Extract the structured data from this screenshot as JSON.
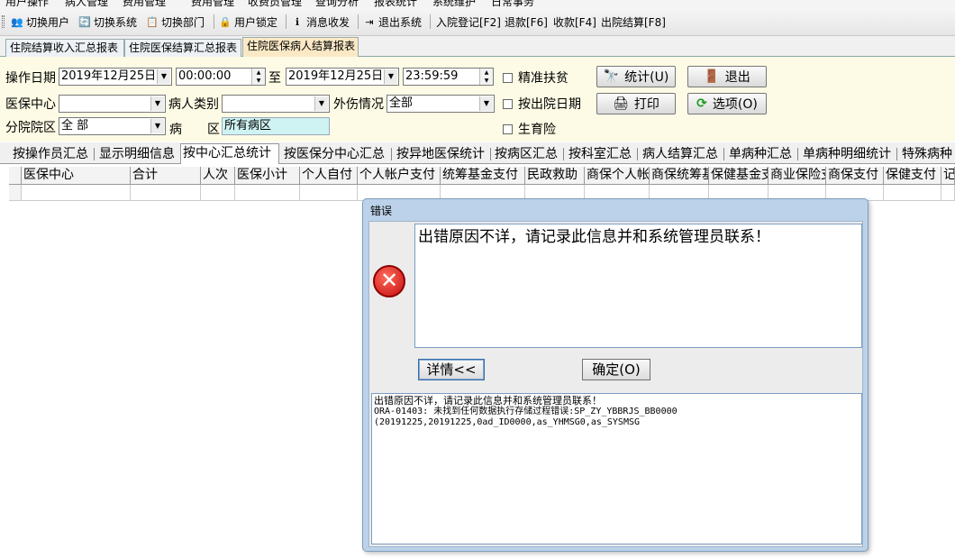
{
  "menubar": [
    "用户操作",
    "病人管理",
    "费用管理",
    "费用管理",
    "收费员管理",
    "查询分析",
    "报表统计",
    "系统维护",
    "日常事务"
  ],
  "toolbar": {
    "items": [
      {
        "label": "切换用户",
        "icon": "users-switch-icon"
      },
      {
        "label": "切换系统",
        "icon": "system-switch-icon"
      },
      {
        "label": "切换部门",
        "icon": "department-switch-icon"
      },
      {
        "label": "用户锁定",
        "icon": "user-lock-icon"
      },
      {
        "label": "消息收发",
        "icon": "info-icon"
      },
      {
        "label": "退出系统",
        "icon": "exit-icon"
      },
      {
        "label": "入院登记[F2]"
      },
      {
        "label": "退款[F6]"
      },
      {
        "label": "收款[F4]"
      },
      {
        "label": "出院结算[F8]"
      }
    ]
  },
  "report_tabs": [
    "住院结算收入汇总报表",
    "住院医保结算汇总报表",
    "住院医保病人结算报表"
  ],
  "filter": {
    "op_date_label": "操作日期",
    "date_from": "2019年12月25日",
    "time_from": "00:00:00",
    "to_label": "至",
    "date_to": "2019年12月25日",
    "time_to": "23:59:59",
    "precise_poverty": "精准扶贫",
    "by_discharge_date": "按出院日期",
    "maternity_insurance": "生育险",
    "insurance_center_label": "医保中心",
    "insurance_center_value": "",
    "patient_type_label": "病人类别",
    "patient_type_value": "",
    "injury_label": "外伤情况",
    "injury_value": "全部",
    "branch_label": "分院院区",
    "branch_value": "全 部",
    "ward_label_1": "病",
    "ward_label_2": "区",
    "ward_value": "所有病区"
  },
  "buttons": {
    "stats": "统计(U)",
    "exit": "退出",
    "print": "打印",
    "options": "选项(O)"
  },
  "sub_tabs": [
    "按操作员汇总",
    "显示明细信息",
    "按中心汇总统计",
    "按医保分中心汇总",
    "按异地医保统计",
    "按病区汇总",
    "按科室汇总",
    "病人结算汇总",
    "单病种汇总",
    "单病种明细统计",
    "特殊病种"
  ],
  "grid": {
    "columns": [
      "医保中心",
      "合计",
      "人次",
      "医保小计",
      "个人自付",
      "个人帐户支付",
      "统筹基金支付",
      "民政救助",
      "商保个人帐",
      "商保统筹基",
      "保健基金支",
      "商业保险支",
      "商保支付",
      "保健支付",
      "记"
    ]
  },
  "dialog": {
    "title": "错误",
    "message": "出错原因不详，请记录此信息并和系统管理员联系！",
    "details_button": "详情<<",
    "ok_button": "确定(O)",
    "details": [
      "出错原因不详，请记录此信息并和系统管理员联系！",
      "ORA-01403: 未找到任何数据执行存储过程错误:SP_ZY_YBBRJS_BB0000",
      "(20191225,20191225,0ad_ID0000,as_YHMSG0,as_SYSMSG"
    ]
  }
}
